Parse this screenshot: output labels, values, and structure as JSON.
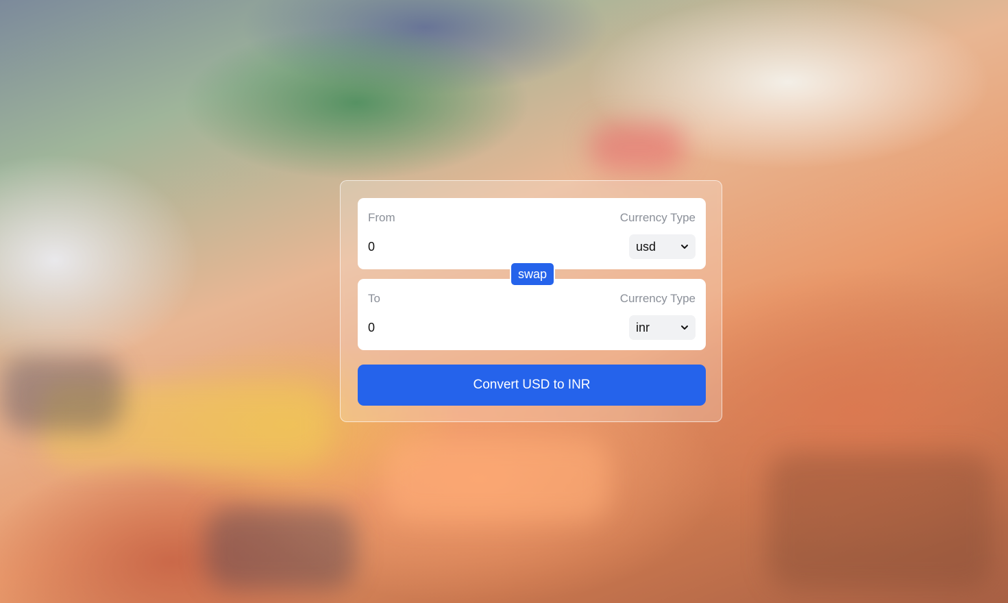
{
  "from": {
    "label": "From",
    "currency_type_label": "Currency Type",
    "amount": "0",
    "currency": "usd"
  },
  "to": {
    "label": "To",
    "currency_type_label": "Currency Type",
    "amount": "0",
    "currency": "inr"
  },
  "swap_label": "swap",
  "convert_label": "Convert USD to INR",
  "colors": {
    "accent": "#2563eb",
    "card_bg": "#ffffff",
    "select_bg": "#f1f2f4",
    "label_text": "#8a8f98"
  },
  "icons": {
    "select_arrow": "chevron-down-icon"
  }
}
